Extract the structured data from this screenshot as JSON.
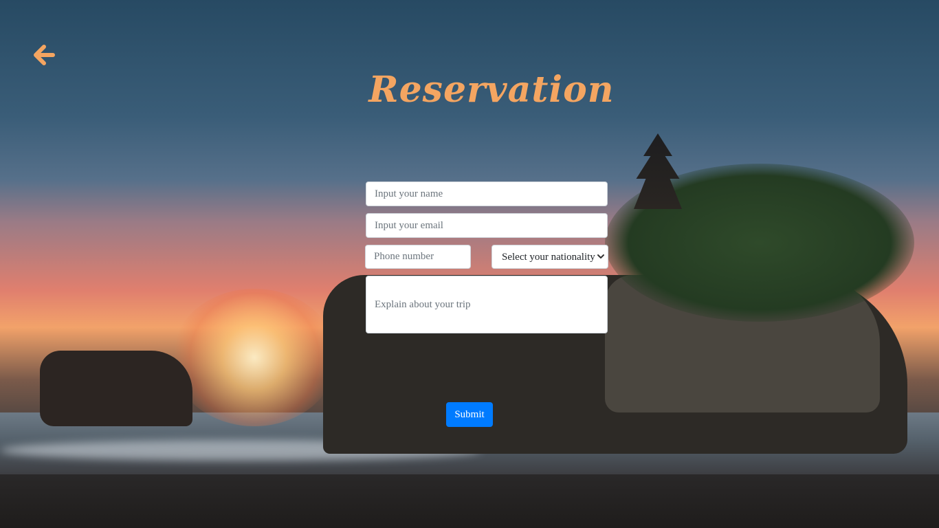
{
  "page": {
    "title": "Reservation"
  },
  "colors": {
    "accent": "#f4a561",
    "primary_button": "#007bff"
  },
  "navigation": {
    "back_icon": "arrow-left-icon"
  },
  "form": {
    "name_placeholder": "Input your name",
    "email_placeholder": "Input your email",
    "phone_placeholder": "Phone number",
    "nationality_selected": "Select your nationality",
    "trip_placeholder": "Explain about your trip",
    "submit_label": "Submit"
  }
}
